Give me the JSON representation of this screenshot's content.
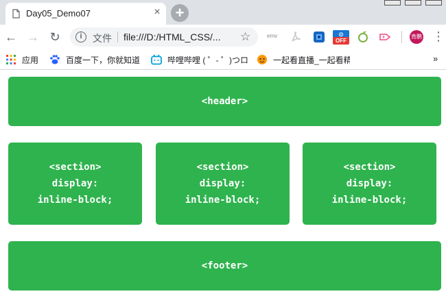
{
  "tab": {
    "title": "Day05_Demo07",
    "close": "×",
    "new_tab": "+"
  },
  "toolbar": {
    "back": "←",
    "forward": "→",
    "reload": "↻",
    "info": "i",
    "scheme_label": "文件",
    "url": "file:///D:/HTML_CSS/...",
    "star": "☆",
    "ext_emv": "emv",
    "ext_off": "OFF",
    "avatar_text": "肯鹏",
    "menu": "⋮"
  },
  "bookmarks": {
    "apps": "应用",
    "items": [
      "百度一下，你就知道",
      "哔哩哔哩 ( ゜- ゜)つロ",
      "一起看直播_一起看精"
    ],
    "more": "»"
  },
  "page": {
    "header": "<header>",
    "sections": [
      {
        "lines": [
          "<section>",
          "display:",
          "inline-block;"
        ]
      },
      {
        "lines": [
          "<section>",
          "display:",
          "inline-block;"
        ]
      },
      {
        "lines": [
          "<section>",
          "display:",
          "inline-block;"
        ]
      }
    ],
    "footer": "<footer>"
  },
  "colors": {
    "block_green": "#2fb34e",
    "tabstrip": "#dee1e6",
    "omnibox": "#f1f3f4"
  },
  "icons": [
    "page-icon",
    "close-icon",
    "plus-icon",
    "back-arrow-icon",
    "forward-arrow-icon",
    "reload-icon",
    "info-icon",
    "star-icon",
    "emv-icon",
    "pdf-icon",
    "extension-icon",
    "off-icon",
    "lime-icon",
    "arrow-tag-icon",
    "avatar-icon",
    "more-vert-icon",
    "apps-grid-icon",
    "baidu-paw-icon",
    "bilibili-icon",
    "yiqikan-icon",
    "chevron-double-right-icon"
  ]
}
